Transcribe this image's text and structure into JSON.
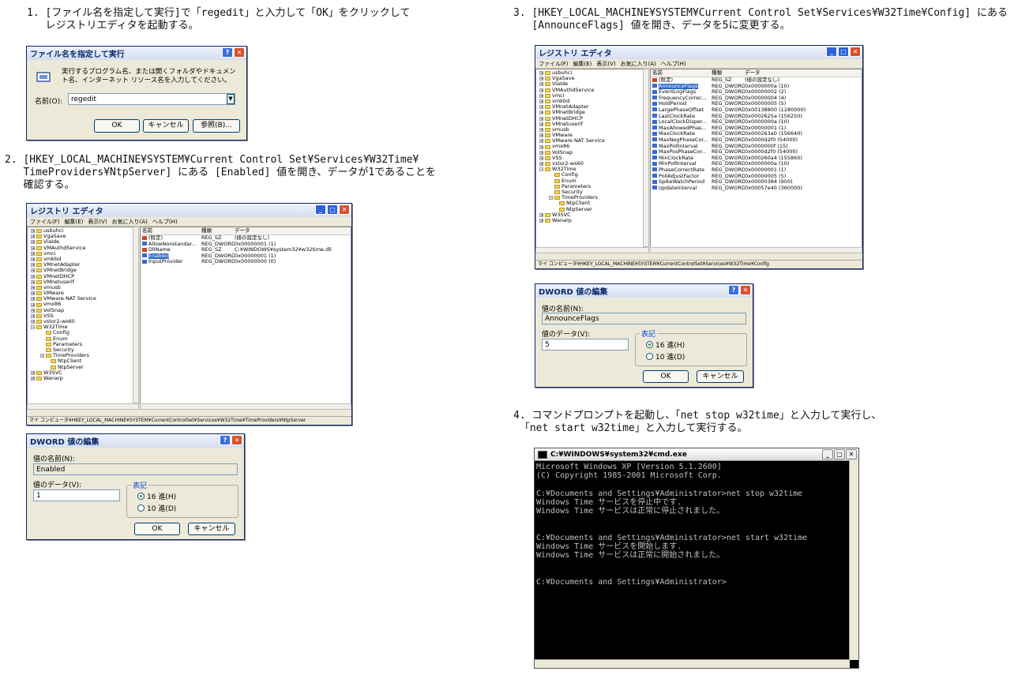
{
  "steps": {
    "s1": "1. [ファイル名を指定して実行]で「regedit」と入力して「OK」をクリックして\n   レジストリエディタを起動する。",
    "s2": "2. [HKEY_LOCAL_MACHINE¥SYSTEM¥Current Control Set¥Services¥W32Time¥\n   TimeProviders¥NtpServer] にある [Enabled] 値を開き、データが1であることを\n   確認する。",
    "s3": "3. [HKEY_LOCAL_MACHINE¥SYSTEM¥Current Control Set¥Services¥W32Time¥Config] にある\n   [AnnounceFlags] 値を開き、データを5に変更する。",
    "s4": "4. コマンドプロンプトを起動し、「net stop w32time」と入力して実行し、\n 「net start w32time」と入力して実行する。"
  },
  "run_dialog": {
    "title": "ファイル名を指定して実行",
    "description": "実行するプログラム名、または開くフォルダやドキュメント名、インターネット リソース名を入力してください。",
    "name_label": "名前(O):",
    "name_value": "regedit",
    "ok": "OK",
    "cancel": "キャンセル",
    "browse": "参照(B)..."
  },
  "regedit": {
    "title": "レジストリ エディタ",
    "menu": [
      "ファイル(F)",
      "編集(E)",
      "表示(V)",
      "お気に入り(A)",
      "ヘルプ(H)"
    ],
    "columns": [
      "名前",
      "種類",
      "データ"
    ],
    "tree": [
      "usbuhci",
      "VgaSave",
      "ViaIde",
      "VMAuthdService",
      "vmci",
      "vmkbd",
      "VMnetAdapter",
      "VMnetBridge",
      "VMnetDHCP",
      "VMnetuserif",
      "vmusb",
      "VMware",
      "VMware NAT Service",
      "vmx86",
      "VolSnap",
      "VSS",
      "vstor2-ws60",
      "W32Time",
      "Config",
      "Enum",
      "Parameters",
      "Security",
      "TimeProviders",
      "NtpClient",
      "NtpServer",
      "W3SVC",
      "Wanarp"
    ]
  },
  "regedit1": {
    "rows": [
      [
        "(既定)",
        "REG_SZ",
        "(値の設定なし)"
      ],
      [
        "AllowNonstandar...",
        "REG_DWORD",
        "0x00000001 (1)"
      ],
      [
        "DllName",
        "REG_SZ",
        "C:¥WINDOWS¥system32¥w32time.dll"
      ],
      [
        "Enabled",
        "REG_DWORD",
        "0x00000001 (1)"
      ],
      [
        "InputProvider",
        "REG_DWORD",
        "0x00000000 (0)"
      ]
    ],
    "status": "マイ コンピュータ¥HKEY_LOCAL_MACHINE¥SYSTEM¥CurrentControlSet¥Services¥W32Time¥TimeProviders¥NtpServer"
  },
  "regedit2": {
    "rows": [
      [
        "(既定)",
        "REG_SZ",
        "(値の設定なし)"
      ],
      [
        "AnnounceFlags",
        "REG_DWORD",
        "0x0000000a (10)"
      ],
      [
        "EventLogFlags",
        "REG_DWORD",
        "0x00000002 (2)"
      ],
      [
        "FrequencyCorrec...",
        "REG_DWORD",
        "0x00000004 (4)"
      ],
      [
        "HoldPeriod",
        "REG_DWORD",
        "0x00000005 (5)"
      ],
      [
        "LargePhaseOffset",
        "REG_DWORD",
        "0x00138800 (1280000)"
      ],
      [
        "LastClockRate",
        "REG_DWORD",
        "0x0002625a (156250)"
      ],
      [
        "LocalClockDisper...",
        "REG_DWORD",
        "0x0000000a (10)"
      ],
      [
        "MaxAllowedPhas...",
        "REG_DWORD",
        "0x00000001 (1)"
      ],
      [
        "MaxClockRate",
        "REG_DWORD",
        "0x000263a0 (156640)"
      ],
      [
        "MaxNegPhaseCor...",
        "REG_DWORD",
        "0x0000d2f0 (54000)"
      ],
      [
        "MaxPollInterval",
        "REG_DWORD",
        "0x0000000f (15)"
      ],
      [
        "MaxPosPhaseCor...",
        "REG_DWORD",
        "0x0000d2f0 (54000)"
      ],
      [
        "MinClockRate",
        "REG_DWORD",
        "0x000260a4 (155860)"
      ],
      [
        "MinPollInterval",
        "REG_DWORD",
        "0x0000000a (10)"
      ],
      [
        "PhaseCorrectRate",
        "REG_DWORD",
        "0x00000001 (1)"
      ],
      [
        "PollAdjustFactor",
        "REG_DWORD",
        "0x00000005 (5)"
      ],
      [
        "SpikeWatchPeriod",
        "REG_DWORD",
        "0x00000384 (900)"
      ],
      [
        "UpdateInterval",
        "REG_DWORD",
        "0x00057e40 (360000)"
      ]
    ],
    "status": "マイ コンピュータ¥HKEY_LOCAL_MACHINE¥SYSTEM¥CurrentControlSet¥Services¥W32Time¥Config"
  },
  "dword1": {
    "title": "DWORD 値の編集",
    "name_label": "値の名前(N):",
    "name_value": "Enabled",
    "data_label": "値のデータ(V):",
    "data_value": "1",
    "base_label": "表記",
    "hex": "16 進(H)",
    "dec": "10 進(D)",
    "ok": "OK",
    "cancel": "キャンセル"
  },
  "dword2": {
    "title": "DWORD 値の編集",
    "name_label": "値の名前(N):",
    "name_value": "AnnounceFlags",
    "data_label": "値のデータ(V):",
    "data_value": "5",
    "base_label": "表記",
    "hex": "16 進(H)",
    "dec": "10 進(D)",
    "ok": "OK",
    "cancel": "キャンセル"
  },
  "cmd": {
    "title": "C:¥WINDOWS¥system32¥cmd.exe",
    "text": "Microsoft Windows XP [Version 5.1.2600]\n(C) Copyright 1985-2001 Microsoft Corp.\n\nC:¥Documents and Settings¥Administrator>net stop w32time\nWindows Time サービスを停止中です.\nWindows Time サービスは正常に停止されました。\n\n\nC:¥Documents and Settings¥Administrator>net start w32time\nWindows Time サービスを開始します.\nWindows Time サービスは正常に開始されました。\n\n\nC:¥Documents and Settings¥Administrator>"
  },
  "colors": {
    "titlebar": "#1c4fbd",
    "selection": "#316ac5",
    "close": "#d9502e"
  }
}
